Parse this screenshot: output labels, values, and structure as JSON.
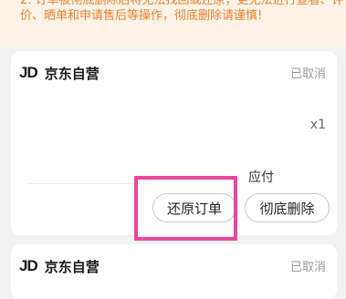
{
  "notice": {
    "line1": "2. 订单被彻底删除后将无法找回或还原，更无法进行查看、评",
    "line2": "价、晒单和申请售后等操作，彻底删除请谨慎!",
    "line3": ""
  },
  "orders": [
    {
      "logo": "JD",
      "shop_name": "京东自营",
      "status": "已取消",
      "quantity": "x1",
      "payable_label": "应付",
      "restore_label": "还原订单",
      "delete_label": "彻底删除"
    },
    {
      "logo": "JD",
      "shop_name": "京东自营",
      "status": "已取消"
    }
  ],
  "colors": {
    "notice_bg": "#fdf3e6",
    "notice_text": "#e8802f",
    "highlight": "#e8479a"
  }
}
